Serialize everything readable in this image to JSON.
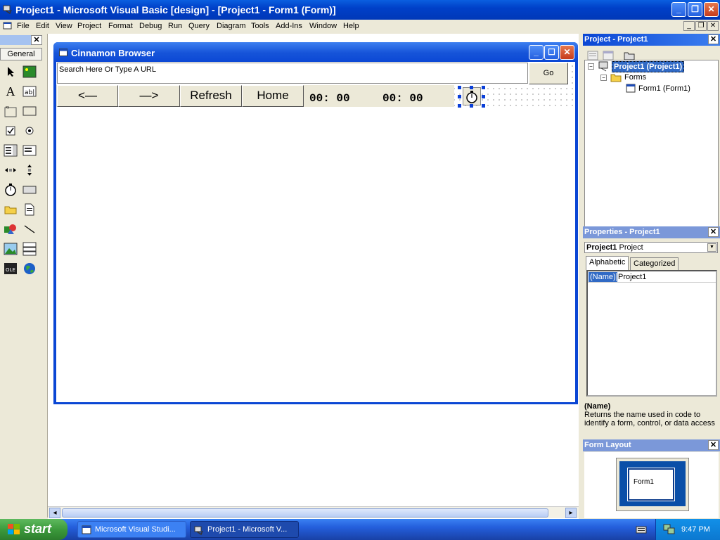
{
  "window": {
    "title": "Project1 - Microsoft Visual Basic [design] - [Project1 - Form1 (Form)]"
  },
  "menu": {
    "items": [
      "File",
      "Edit",
      "View",
      "Project",
      "Format",
      "Debug",
      "Run",
      "Query",
      "Diagram",
      "Tools",
      "Add-Ins",
      "Window",
      "Help"
    ]
  },
  "toolbox": {
    "tab_label": "General"
  },
  "form": {
    "title": "Cinnamon Browser",
    "url_placeholder": "Search Here Or Type A URL",
    "go_label": "Go",
    "back_label": "<—",
    "forward_label": "—>",
    "refresh_label": "Refresh",
    "home_label": "Home",
    "timer1": "00: 00",
    "timer2": "00: 00"
  },
  "project_explorer": {
    "title": "Project - Project1",
    "root": "Project1 (Project1)",
    "folder": "Forms",
    "form_item": "Form1 (Form1)"
  },
  "properties": {
    "title": "Properties - Project1",
    "object_name": "Project1",
    "object_type": "Project",
    "tab_alphabetic": "Alphabetic",
    "tab_categorized": "Categorized",
    "prop_name": "(Name)",
    "prop_value": "Project1",
    "desc_title": "(Name)",
    "desc_text": "Returns the name used in code to identify a form, control, or data access"
  },
  "form_layout": {
    "title": "Form Layout",
    "form_label": "Form1"
  },
  "taskbar": {
    "start_label": "start",
    "tasks": [
      "Microsoft Visual Studi...",
      "Project1 - Microsoft V..."
    ],
    "clock": "9:47 PM"
  }
}
